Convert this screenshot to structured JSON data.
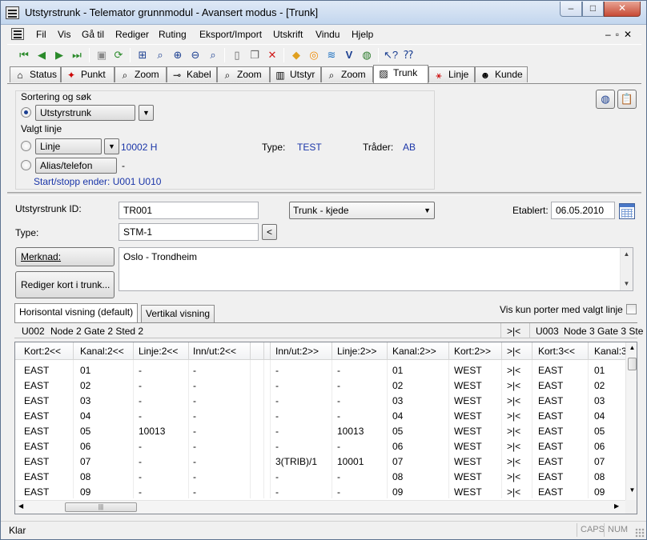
{
  "window": {
    "title": "Utstyrstrunk - Telemator grunnmodul - Avansert modus - [Trunk]",
    "controls": {
      "minimize": "–",
      "maximize": "□",
      "close": "✕"
    }
  },
  "menubar": {
    "items": [
      {
        "label": "Fil"
      },
      {
        "label": "Vis"
      },
      {
        "label": "Gå til"
      },
      {
        "label": "Rediger"
      },
      {
        "label": "Ruting"
      },
      {
        "label": "Eksport/Import"
      },
      {
        "label": "Utskrift"
      },
      {
        "label": "Vindu"
      },
      {
        "label": "Hjelp"
      }
    ],
    "mdi_controls": "–▫✕"
  },
  "toolbar": {
    "icons": [
      "first-record-icon",
      "prev-record-icon",
      "next-record-icon",
      "last-record-icon",
      "save-icon",
      "refresh-icon",
      "tree-icon",
      "zoom-icon",
      "zoom-in-icon",
      "zoom-out-icon",
      "new-icon",
      "copy-icon",
      "delete-icon",
      "map-icon",
      "circle-icon",
      "chart-icon",
      "visio-icon",
      "globe-icon",
      "help-cursor-icon",
      "help-icon"
    ]
  },
  "navtabs": [
    {
      "label": "Status",
      "icon": "⌂"
    },
    {
      "label": "Punkt",
      "icon": "✦"
    },
    {
      "label": "Zoom",
      "icon": "⌕"
    },
    {
      "label": "Kabel",
      "icon": "⊸"
    },
    {
      "label": "Zoom",
      "icon": "⌕"
    },
    {
      "label": "Utstyr",
      "icon": "▥"
    },
    {
      "label": "Zoom",
      "icon": "⌕"
    },
    {
      "label": "Trunk",
      "icon": "▨"
    },
    {
      "label": "Linje",
      "icon": "⚹"
    },
    {
      "label": "Kunde",
      "icon": "☻"
    }
  ],
  "search": {
    "heading": "Sortering og søk",
    "utstyrstrunk_label": "Utstyrstrunk",
    "valgt_linje_heading": "Valgt linje",
    "linje_label": "Linje",
    "linje_value": "10002 H",
    "type_label": "Type:",
    "type_value": "TEST",
    "trader_label": "Tråder:",
    "trader_value": "AB",
    "alias_label": "Alias/telefon",
    "alias_value": "-",
    "start_stopp": "Start/stopp ender: U001  U010"
  },
  "form": {
    "id_label": "Utstyrstrunk ID:",
    "id_value": "TR001",
    "kind_value": "Trunk - kjede",
    "etablert_label": "Etablert:",
    "etablert_value": "06.05.2010",
    "type_label": "Type:",
    "type_value": "STM-1",
    "small_btn": "<",
    "merknad_label": "Merknad:",
    "merknad_value": "Oslo - Trondheim",
    "rediger_label": "Rediger kort i trunk..."
  },
  "subtabs": {
    "tabs": [
      {
        "label": "Horisontal visning (default)"
      },
      {
        "label": "Vertikal visning"
      }
    ],
    "checkbox_label": "Vis kun porter med valgt linje"
  },
  "nodebar": {
    "left_code": "U002",
    "left_name": "Node 2 Gate 2 Sted 2",
    "sep": ">|<",
    "right_code": "U003",
    "right_name": "Node 3 Gate 3 Ste"
  },
  "grid": {
    "headers": [
      "Kort:2<<",
      "Kanal:2<<",
      "Linje:2<<",
      "Inn/ut:2<<",
      "",
      "Inn/ut:2>>",
      "Linje:2>>",
      "Kanal:2>>",
      "Kort:2>>",
      ">|<",
      "Kort:3<<",
      "Kanal:3"
    ],
    "rows": [
      [
        "EAST",
        "01",
        "-",
        "-",
        "",
        "-",
        "-",
        "01",
        "WEST",
        ">|<",
        "EAST",
        "01"
      ],
      [
        "EAST",
        "02",
        "-",
        "-",
        "",
        "-",
        "-",
        "02",
        "WEST",
        ">|<",
        "EAST",
        "02"
      ],
      [
        "EAST",
        "03",
        "-",
        "-",
        "",
        "-",
        "-",
        "03",
        "WEST",
        ">|<",
        "EAST",
        "03"
      ],
      [
        "EAST",
        "04",
        "-",
        "-",
        "",
        "-",
        "-",
        "04",
        "WEST",
        ">|<",
        "EAST",
        "04"
      ],
      [
        "EAST",
        "05",
        "10013",
        "-",
        "",
        "-",
        "10013",
        "05",
        "WEST",
        ">|<",
        "EAST",
        "05"
      ],
      [
        "EAST",
        "06",
        "-",
        "-",
        "",
        "-",
        "-",
        "06",
        "WEST",
        ">|<",
        "EAST",
        "06"
      ],
      [
        "EAST",
        "07",
        "-",
        "-",
        "",
        "3(TRIB)/1",
        "10001",
        "07",
        "WEST",
        ">|<",
        "EAST",
        "07"
      ],
      [
        "EAST",
        "08",
        "-",
        "-",
        "",
        "-",
        "-",
        "08",
        "WEST",
        ">|<",
        "EAST",
        "08"
      ],
      [
        "EAST",
        "09",
        "-",
        "-",
        "",
        "-",
        "-",
        "09",
        "WEST",
        ">|<",
        "EAST",
        "09"
      ]
    ]
  },
  "statusbar": {
    "text": "Klar",
    "caps": "CAPS",
    "num": "NUM"
  }
}
